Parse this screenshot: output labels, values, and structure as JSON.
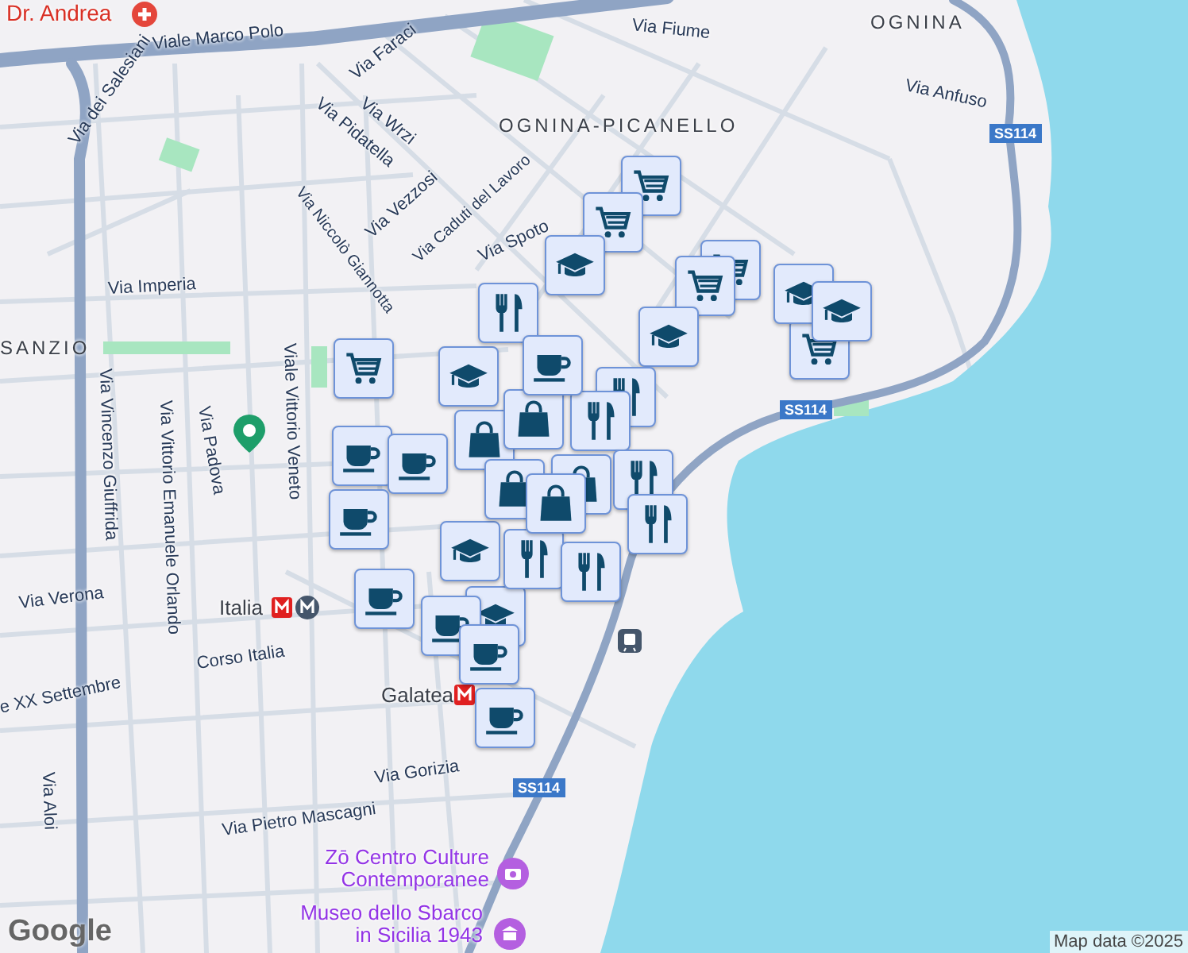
{
  "map": {
    "labels": [
      {
        "text": "Dr. Andrea",
        "kind": "hospital"
      },
      {
        "text": "Viale Marco Polo",
        "kind": "street"
      },
      {
        "text": "Via dei Salesiani",
        "kind": "street"
      },
      {
        "text": "Via Faraci",
        "kind": "street"
      },
      {
        "text": "Via Wrzi",
        "kind": "street"
      },
      {
        "text": "Via Pidatella",
        "kind": "street"
      },
      {
        "text": "Via Vezzosi",
        "kind": "street"
      },
      {
        "text": "Via Caduti del Lavoro",
        "kind": "street"
      },
      {
        "text": "Via Niccolò Giannotta",
        "kind": "street"
      },
      {
        "text": "Via Spoto",
        "kind": "street"
      },
      {
        "text": "Via Imperia",
        "kind": "street"
      },
      {
        "text": "SANZIO",
        "kind": "district"
      },
      {
        "text": "OGNINA-PICANELLO",
        "kind": "district"
      },
      {
        "text": "OGNINA",
        "kind": "district"
      },
      {
        "text": "Via Fiume",
        "kind": "street"
      },
      {
        "text": "Via Anfuso",
        "kind": "street"
      },
      {
        "text": "SS114",
        "kind": "shield"
      },
      {
        "text": "SS114",
        "kind": "shield"
      },
      {
        "text": "SS114",
        "kind": "shield"
      },
      {
        "text": "Viale Vittorio Veneto",
        "kind": "street"
      },
      {
        "text": "Via Padova",
        "kind": "street"
      },
      {
        "text": "Via Vincenzo Giuffrida",
        "kind": "street"
      },
      {
        "text": "Via Vittorio Emanuele Orlando",
        "kind": "street"
      },
      {
        "text": "Via Verona",
        "kind": "street"
      },
      {
        "text": "Italia",
        "kind": "metro"
      },
      {
        "text": "Corso Italia",
        "kind": "street"
      },
      {
        "text": "Galatea",
        "kind": "metro"
      },
      {
        "text": "e XX Settembre",
        "kind": "street"
      },
      {
        "text": "Via Aloi",
        "kind": "street"
      },
      {
        "text": "Via Gorizia",
        "kind": "street"
      },
      {
        "text": "Via Pietro Mascagni",
        "kind": "street"
      },
      {
        "text": "Zō Centro Culture Contemporanee",
        "kind": "attraction"
      },
      {
        "text": "Museo dello Sbarco in Sicilia 1943",
        "kind": "attraction"
      }
    ],
    "markers": [
      {
        "kind": "cart"
      },
      {
        "kind": "cart"
      },
      {
        "kind": "cart"
      },
      {
        "kind": "cart"
      },
      {
        "kind": "cart"
      },
      {
        "kind": "cart"
      },
      {
        "kind": "cap"
      },
      {
        "kind": "cap"
      },
      {
        "kind": "cap"
      },
      {
        "kind": "cap"
      },
      {
        "kind": "cap"
      },
      {
        "kind": "cap"
      },
      {
        "kind": "cap"
      },
      {
        "kind": "food"
      },
      {
        "kind": "food"
      },
      {
        "kind": "food"
      },
      {
        "kind": "food"
      },
      {
        "kind": "food"
      },
      {
        "kind": "food"
      },
      {
        "kind": "food"
      },
      {
        "kind": "bag"
      },
      {
        "kind": "bag"
      },
      {
        "kind": "bag"
      },
      {
        "kind": "bag"
      },
      {
        "kind": "bag"
      },
      {
        "kind": "cup"
      },
      {
        "kind": "cup"
      },
      {
        "kind": "cup"
      },
      {
        "kind": "cup"
      },
      {
        "kind": "cup"
      },
      {
        "kind": "cup"
      },
      {
        "kind": "cup"
      },
      {
        "kind": "cup"
      }
    ]
  },
  "attribution": "Map data ©2025",
  "logo": "Google"
}
